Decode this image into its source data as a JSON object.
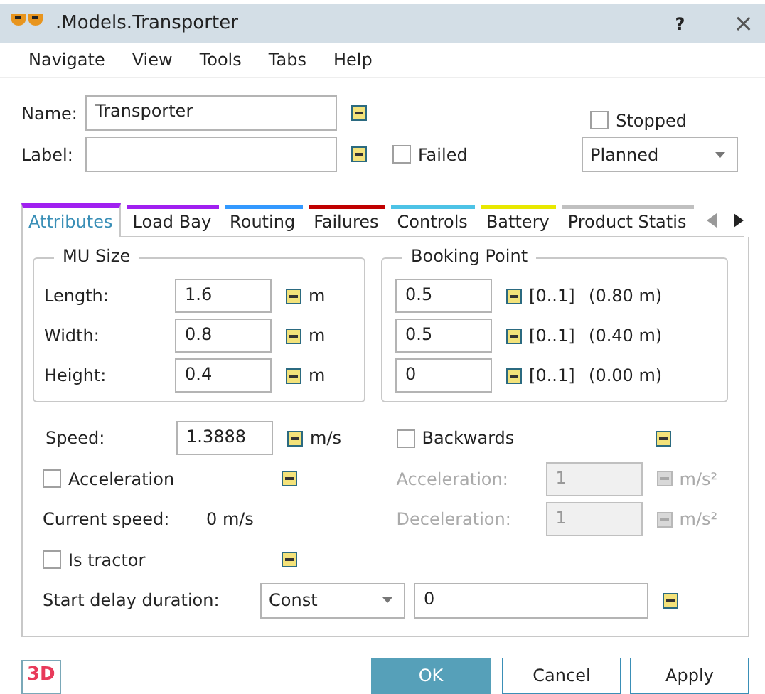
{
  "window": {
    "title": ".Models.Transporter",
    "help": "?",
    "close": "×"
  },
  "menu": [
    "Navigate",
    "View",
    "Tools",
    "Tabs",
    "Help"
  ],
  "header": {
    "name_label": "Name:",
    "name_value": "Transporter",
    "label_label": "Label:",
    "failed": {
      "label": "Failed",
      "checked": false
    },
    "stopped": {
      "label": "Stopped",
      "checked": false
    },
    "state": "Planned"
  },
  "tabs": [
    {
      "label": "Attributes",
      "color": "#a020f0",
      "selected": true
    },
    {
      "label": "Load Bay",
      "color": "#a020f0",
      "selected": false
    },
    {
      "label": "Routing",
      "color": "#3399ff",
      "selected": false
    },
    {
      "label": "Failures",
      "color": "#c00000",
      "selected": false
    },
    {
      "label": "Controls",
      "color": "#4dc3e6",
      "selected": false
    },
    {
      "label": "Battery",
      "color": "#e8e800",
      "selected": false
    },
    {
      "label": "Product Statis",
      "color": "#c0c0c0",
      "selected": false
    }
  ],
  "mu_size": {
    "title": "MU Size",
    "rows": [
      {
        "label": "Length:",
        "value": "1.6",
        "unit": "m"
      },
      {
        "label": "Width:",
        "value": "0.8",
        "unit": "m"
      },
      {
        "label": "Height:",
        "value": "0.4",
        "unit": "m"
      }
    ]
  },
  "booking_point": {
    "title": "Booking Point",
    "rows": [
      {
        "value": "0.5",
        "range": "[0..1]",
        "reading": "(0.80 m)"
      },
      {
        "value": "0.5",
        "range": "[0..1]",
        "reading": "(0.40 m)"
      },
      {
        "value": "0",
        "range": "[0..1]",
        "reading": "(0.00 m)"
      }
    ]
  },
  "speed": {
    "label": "Speed:",
    "value": "1.3888",
    "unit": "m/s"
  },
  "backwards": {
    "label": "Backwards",
    "checked": false
  },
  "acceleration": {
    "label": "Acceleration",
    "checked": false
  },
  "accel_fields": [
    {
      "label": "Acceleration:",
      "value": "1",
      "unit": "m/s²",
      "disabled": true
    },
    {
      "label": "Deceleration:",
      "value": "1",
      "unit": "m/s²",
      "disabled": true
    }
  ],
  "current_speed": {
    "label": "Current speed:",
    "value": "0 m/s"
  },
  "is_tractor": {
    "label": "Is tractor",
    "checked": false
  },
  "start_delay": {
    "label": "Start delay duration:",
    "mode": "Const",
    "value": "0"
  },
  "footer": {
    "logo": "3D",
    "buttons": [
      {
        "label": "OK",
        "default": true
      },
      {
        "label": "Cancel",
        "default": false
      },
      {
        "label": "Apply",
        "default": false
      }
    ]
  }
}
